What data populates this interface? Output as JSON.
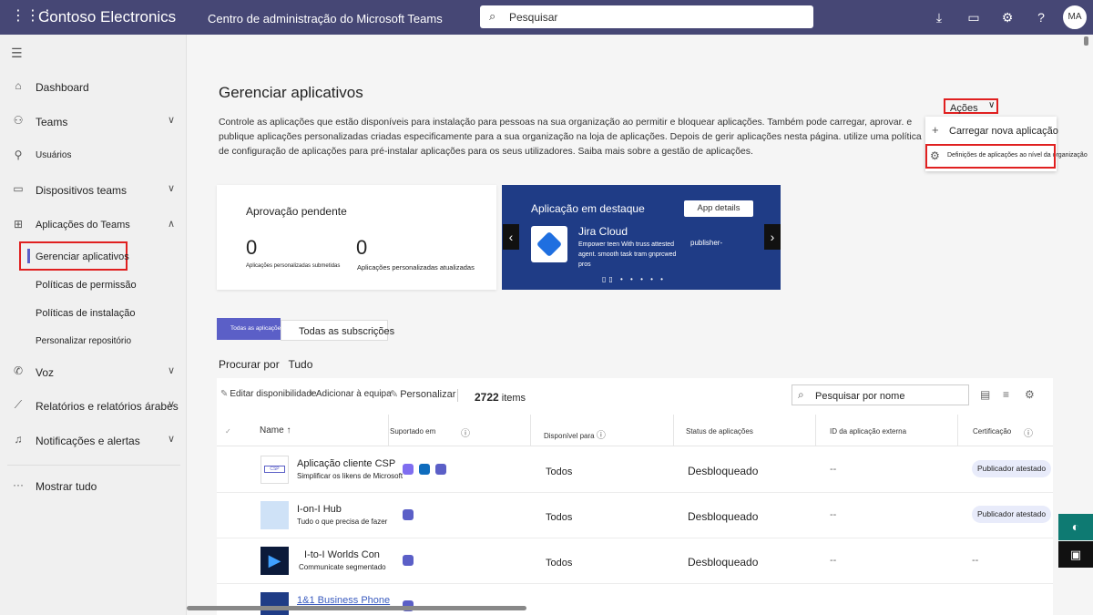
{
  "topbar": {
    "brand": "Contoso Electronics",
    "title": "Centro de administração do Microsoft Teams",
    "search_placeholder": "Pesquisar",
    "avatar": "MA"
  },
  "nav": {
    "items": [
      {
        "label": "Dashboard"
      },
      {
        "label": "Teams"
      },
      {
        "label": "Usuários"
      },
      {
        "label": "Dispositivos teams"
      },
      {
        "label": "Aplicações do Teams"
      },
      {
        "label": "Voz"
      },
      {
        "label": "Relatórios e relatórios árabes"
      },
      {
        "label": "Notificações e alertas"
      },
      {
        "label": "Mostrar tudo"
      }
    ],
    "subitems": [
      {
        "label": "Gerenciar aplicativos"
      },
      {
        "label": "Políticas de permissão"
      },
      {
        "label": "Políticas de instalação"
      },
      {
        "label": "Personalizar repositório"
      }
    ]
  },
  "page": {
    "title": "Gerenciar aplicativos",
    "description": "Controle as aplicações que estão disponíveis para instalação para pessoas na sua organização ao permitir e bloquear aplicações. Também pode carregar, aprovar. e publique aplicações personalizadas criadas especificamente para a sua organização na loja de aplicações. Depois de gerir aplicações nesta página. utilize uma política de configuração de aplicações para pré-instalar aplicações para os seus utilizadores. Saiba mais sobre a gestão de aplicações.",
    "actions_label": "Ações",
    "menu": {
      "upload": "Carregar nova aplicação",
      "org_settings": "Definições de aplicações ao nível da organização"
    }
  },
  "pending": {
    "title": "Aprovação pendente",
    "submitted_count": "0",
    "submitted_label": "Aplicações personalizadas submetidas",
    "updated_count": "0",
    "updated_label": "Aplicações personalizadas atualizadas"
  },
  "featured": {
    "title": "Aplicação em destaque",
    "button": "App details",
    "app_name": "Jira Cloud",
    "app_desc": "Empower teen With truss attested agent. smooth task tram gnprcwed pros",
    "publisher": "publisher-",
    "pager": "▯▯ • • • • •"
  },
  "tabs": {
    "all_apps": "Todas as aplicações",
    "all_subs": "Todas as subscrições"
  },
  "browse": {
    "label": "Procurar por",
    "value": "Tudo"
  },
  "toolbar": {
    "edit": "Editar disponibilidade",
    "add": "Adicionar à equipa",
    "customize": "Personalizar",
    "count": "2722",
    "count_unit": "items",
    "search_placeholder": "Pesquisar por nome"
  },
  "table": {
    "headers": {
      "name": "Name",
      "supported": "Suportado em",
      "available": "Disponível para",
      "status": "Status de aplicações",
      "external_id": "ID da aplicação externa",
      "cert": "Certificação"
    },
    "rows": [
      {
        "name": "Aplicação cliente CSP",
        "sub": "Simplificar os likens de Microsoft",
        "available": "Todos",
        "status": "Desbloqueado",
        "ext": "--",
        "cert": "Publicador atestado"
      },
      {
        "name": "I-on-I Hub",
        "sub": "Tudo o que precisa de fazer",
        "available": "Todos",
        "status": "Desbloqueado",
        "ext": "--",
        "cert": "Publicador atestado"
      },
      {
        "name": "I-to-I Worlds Con",
        "sub": "Communicate segmentado",
        "available": "Todos",
        "status": "Desbloqueado",
        "ext": "--",
        "cert": "--"
      },
      {
        "name": "1&1 Business Phone",
        "sub": "",
        "available": "",
        "status": "",
        "ext": "",
        "cert": ""
      }
    ]
  },
  "colors": {
    "topbar": "#464775",
    "accent": "#5b5fc7",
    "highlight": "#e02020",
    "featured_bg": "#1f3c86"
  }
}
